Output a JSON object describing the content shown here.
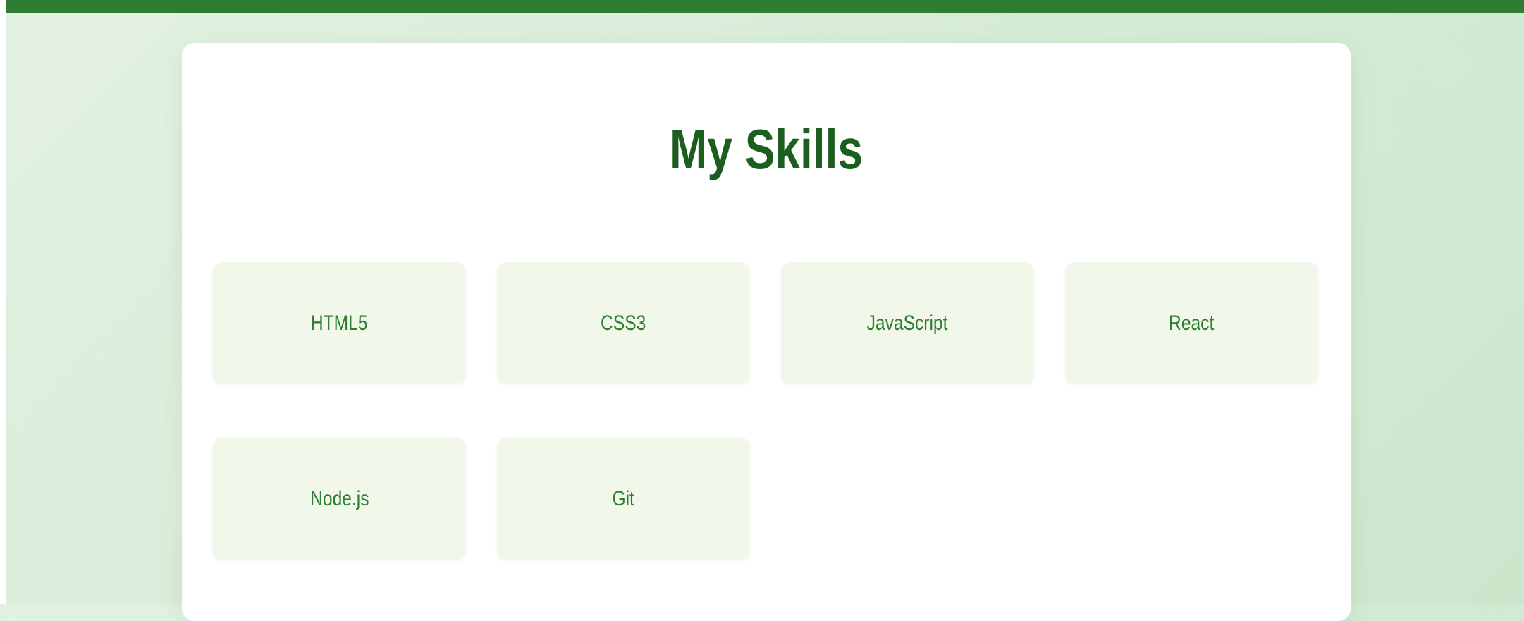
{
  "page": {
    "title": "My Skills",
    "colors": {
      "accent": "#2e7d32",
      "title": "#1b5e20",
      "tile_background": "#f1f8e9",
      "card_background": "#ffffff"
    }
  },
  "skills": [
    {
      "label": "HTML5"
    },
    {
      "label": "CSS3"
    },
    {
      "label": "JavaScript"
    },
    {
      "label": "React"
    },
    {
      "label": "Node.js"
    },
    {
      "label": "Git"
    }
  ]
}
